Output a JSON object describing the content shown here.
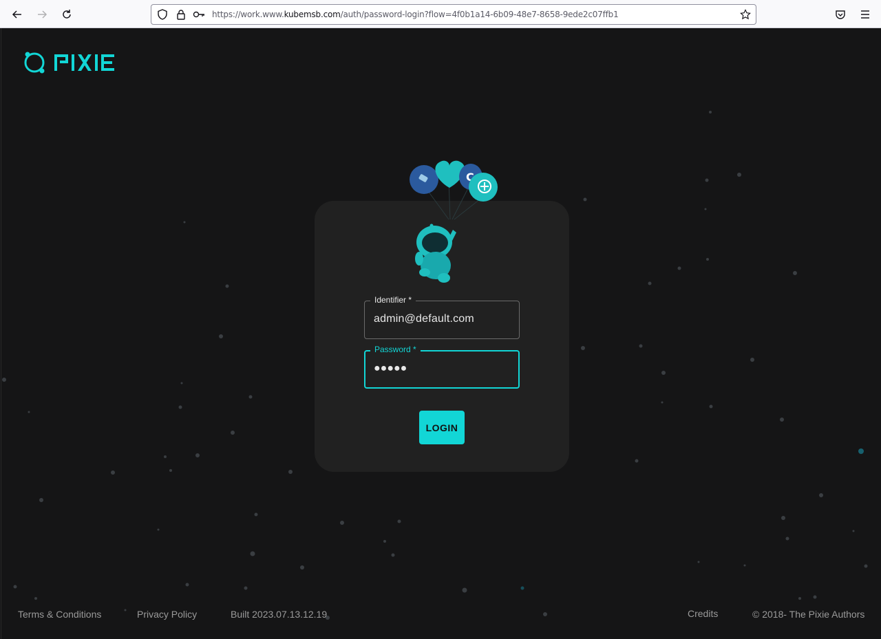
{
  "browser": {
    "url_prefix": "https://work.www.",
    "url_domain": "kubemsb.com",
    "url_path": "/auth/password-login?flow=4f0b1a14-6b09-48e7-8658-9ede2c07ffb1",
    "icons": {
      "back": "arrow-left-icon",
      "forward": "arrow-right-icon",
      "reload": "reload-icon",
      "shield": "shield-icon",
      "lock": "lock-icon",
      "key": "key-icon",
      "bookmark": "star-icon",
      "pocket": "pocket-icon",
      "menu": "hamburger-menu-icon"
    }
  },
  "brand": {
    "name": "PIXIE",
    "accent_color": "#12d6d6"
  },
  "login_form": {
    "identifier_label": "Identifier *",
    "identifier_value": "admin@default.com",
    "password_label": "Password *",
    "password_value": "●●●●●",
    "login_label": "LOGIN"
  },
  "footer": {
    "terms": "Terms & Conditions",
    "privacy": "Privacy Policy",
    "build": "Built 2023.07.13.12.19",
    "credits": "Credits",
    "copyright": "© 2018- The Pixie Authors"
  }
}
